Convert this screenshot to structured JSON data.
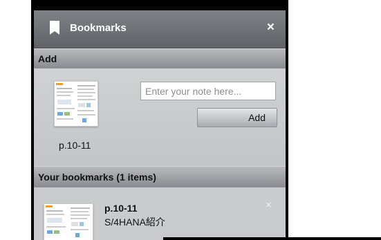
{
  "header": {
    "title": "Bookmarks",
    "close_icon": "×"
  },
  "add_section": {
    "title": "Add",
    "page_label": "p.10-11",
    "input_placeholder": "Enter your note here...",
    "add_button": "Add"
  },
  "list_section": {
    "title": "Your bookmarks (1 items)",
    "items": [
      {
        "page": "p.10-11",
        "note": "S/4HANA紹介",
        "remove_icon": "×"
      }
    ]
  },
  "colors": {
    "header": "#6a6e73",
    "section_bar": "#9fa2a6",
    "panel": "#c6c8ca"
  }
}
